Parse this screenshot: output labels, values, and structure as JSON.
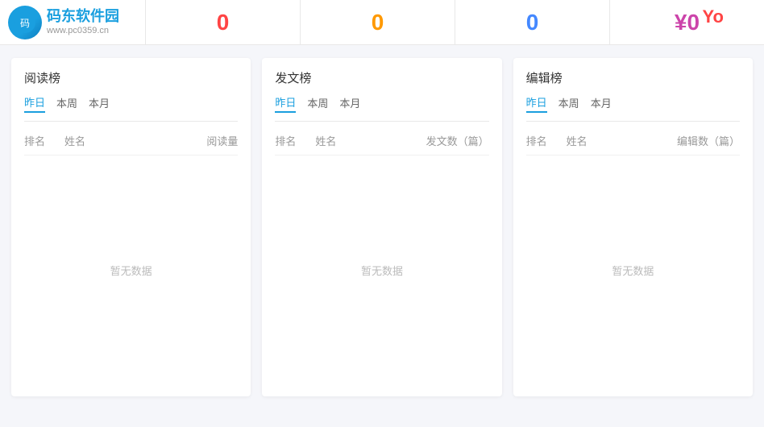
{
  "header": {
    "logo": {
      "main_text": "码东软件园",
      "sub_text": "www.pc0359.cn",
      "icon_char": "码"
    },
    "stats": [
      {
        "value": "0",
        "color_class": "red"
      },
      {
        "value": "0",
        "color_class": "orange"
      },
      {
        "value": "0",
        "color_class": "blue"
      },
      {
        "value": "¥0",
        "color_class": "pink"
      }
    ]
  },
  "cards": [
    {
      "title": "阅读榜",
      "tabs": [
        "昨日",
        "本周",
        "本月"
      ],
      "active_tab": 0,
      "columns": [
        "排名",
        "姓名",
        "阅读量"
      ],
      "empty_text": "暂无数据"
    },
    {
      "title": "发文榜",
      "tabs": [
        "昨日",
        "本周",
        "本月"
      ],
      "active_tab": 0,
      "columns": [
        "排名",
        "姓名",
        "发文数（篇）"
      ],
      "empty_text": "暂无数据"
    },
    {
      "title": "编辑榜",
      "tabs": [
        "昨日",
        "本周",
        "本月"
      ],
      "active_tab": 0,
      "columns": [
        "排名",
        "姓名",
        "编辑数（篇）"
      ],
      "empty_text": "暂无数据"
    }
  ],
  "top_right": {
    "text": "Yo"
  }
}
